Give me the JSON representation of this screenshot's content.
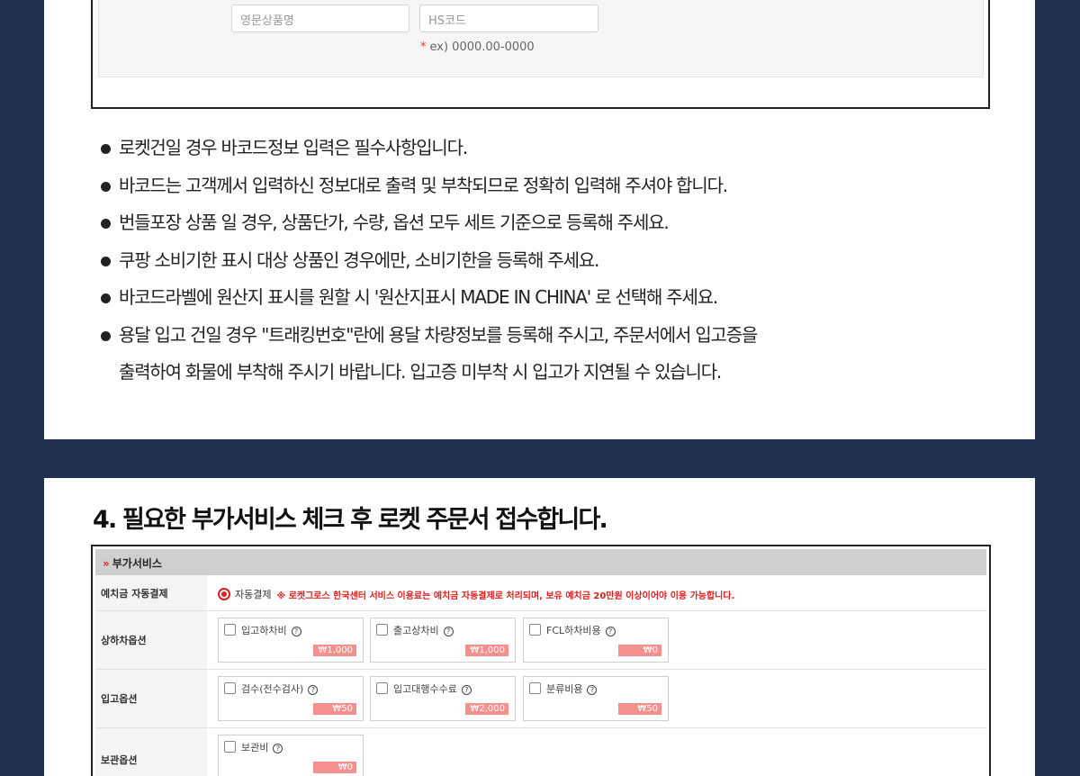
{
  "form_top": {
    "english_name_placeholder": "영문상품명",
    "hs_code_placeholder": "HS코드",
    "hint_star": "*",
    "hint_text": "ex) 0000.00-0000"
  },
  "notes": [
    "로켓건일 경우 바코드정보 입력은 필수사항입니다.",
    "바코드는 고객께서 입력하신 정보대로 출력 및 부착되므로 정확히 입력해 주셔야 합니다.",
    "번들포장 상품 일 경우, 상품단가, 수량, 옵션 모두 세트 기준으로 등록해 주세요.",
    "쿠팡 소비기한 표시 대상 상품인 경우에만, 소비기한을 등록해 주세요.",
    "바코드라벨에 원산지 표시를 원할 시 '원산지표시 MADE IN CHINA' 로 선택해 주세요.",
    "용달 입고 건일 경우 \"트래킹번호\"란에 용달 차량정보를 등록해 주시고, 주문서에서 입고증을",
    "출력하여 화물에 부착해 주시기 바랍니다. 입고증 미부착 시 입고가 지연될 수 있습니다."
  ],
  "step4": {
    "title": "4. 필요한 부가서비스 체크 후 로켓 주문서 접수합니다.",
    "section_icon": "double-chevron-right",
    "section_label": "부가서비스",
    "deposit_row": {
      "label": "예치금 자동결제",
      "radio_label": "자동결제",
      "notice": "※ 로켓그로스 한국센터 서비스 이용료는 예치금 자동결제로 처리되며, 보유 예치금 20만원 이상이어야 이용 가능합니다."
    },
    "rows": [
      {
        "label": "상하차옵션",
        "options": [
          {
            "name": "입고하차비",
            "price": "₩1,000"
          },
          {
            "name": "출고상차비",
            "price": "₩1,000"
          },
          {
            "name": "FCL하차비용",
            "price": "₩0"
          }
        ]
      },
      {
        "label": "입고옵션",
        "options": [
          {
            "name": "검수(전수검사)",
            "price": "₩50"
          },
          {
            "name": "입고대행수수료",
            "price": "₩2,000"
          },
          {
            "name": "분류비용",
            "price": "₩50"
          }
        ]
      },
      {
        "label": "보관옵션",
        "options": [
          {
            "name": "보관비",
            "price": "₩0"
          }
        ]
      }
    ],
    "help_icon_glyph": "?"
  },
  "colors": {
    "background": "#1e3150",
    "accent_red": "#e02020",
    "price_badge": "#f4908d",
    "section_header": "#cfcfcf"
  }
}
